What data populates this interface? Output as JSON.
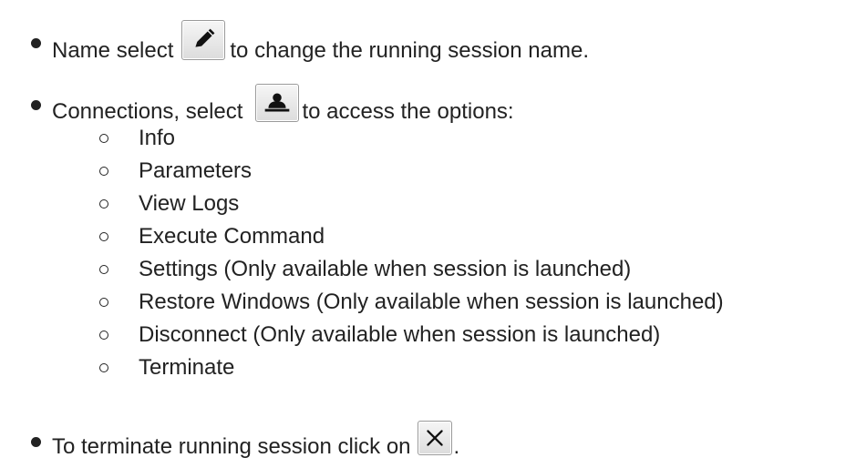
{
  "items": [
    {
      "before": "Name select",
      "after": "to change the running session name.",
      "icon": "pencil-icon"
    },
    {
      "before": "Connections, select",
      "after": "to access the options:",
      "icon": "user-icon",
      "options": [
        "Info",
        "Parameters",
        "View Logs",
        "Execute Command",
        "Settings (Only available when session is launched)",
        "Restore Windows (Only available when session is launched)",
        "Disconnect (Only available when session is launched)",
        "Terminate"
      ]
    },
    {
      "before": "To terminate running session click on",
      "after": ".",
      "icon": "close-icon"
    }
  ]
}
